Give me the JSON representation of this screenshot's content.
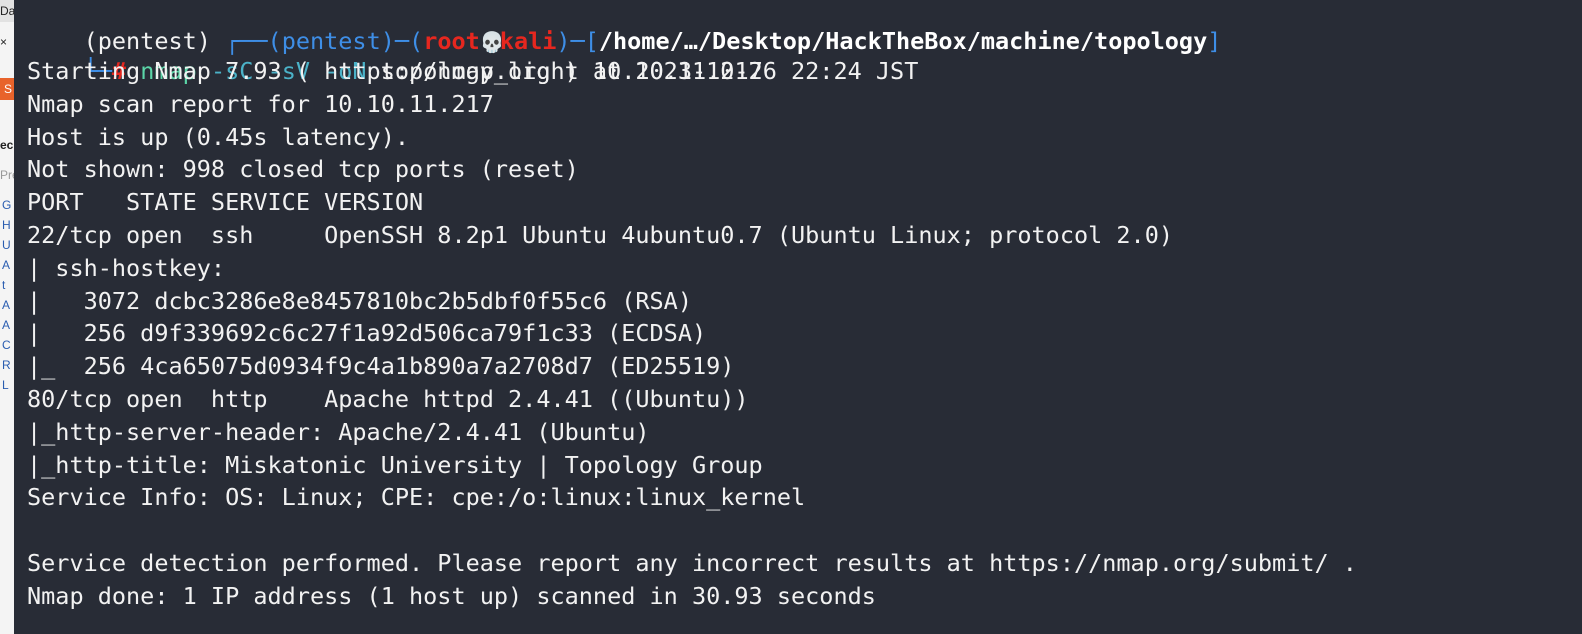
{
  "background_window": {
    "top_tab_fragment": "Das",
    "close_glyph": "×",
    "orange_fragment": "S",
    "section_fragment": "ec",
    "pre_fragment": "Pre",
    "links": [
      "G",
      "H",
      "U",
      "A",
      "t",
      "A",
      "A",
      "C",
      "R",
      "L"
    ]
  },
  "terminal": {
    "prompt": {
      "venv": "(pentest)",
      "corner_top": "┌──",
      "venv_inner": "(pentest)",
      "dash": "─",
      "open_paren": "(",
      "user": "root",
      "skull": "💀",
      "host": "kali",
      "close_paren": ")",
      "dash2": "─",
      "open_bracket": "[",
      "path": "/home/…/Desktop/HackTheBox/machine/topology",
      "close_bracket": "]",
      "corner_bottom": "└─",
      "hash": "#",
      "command": "nmap",
      "flags": "-sC -sV -oN",
      "args": "topology_light 10.10.11.217"
    },
    "output_lines": [
      "Starting Nmap 7.93 ( https://nmap.org ) at 2023-10-26 22:24 JST",
      "Nmap scan report for 10.10.11.217",
      "Host is up (0.45s latency).",
      "Not shown: 998 closed tcp ports (reset)",
      "PORT   STATE SERVICE VERSION",
      "22/tcp open  ssh     OpenSSH 8.2p1 Ubuntu 4ubuntu0.7 (Ubuntu Linux; protocol 2.0)",
      "| ssh-hostkey: ",
      "|   3072 dcbc3286e8e8457810bc2b5dbf0f55c6 (RSA)",
      "|   256 d9f339692c6c27f1a92d506ca79f1c33 (ECDSA)",
      "|_  256 4ca65075d0934f9c4a1b890a7a2708d7 (ED25519)",
      "80/tcp open  http    Apache httpd 2.4.41 ((Ubuntu))",
      "|_http-server-header: Apache/2.4.41 (Ubuntu)",
      "|_http-title: Miskatonic University | Topology Group",
      "Service Info: OS: Linux; CPE: cpe:/o:linux:linux_kernel",
      "",
      "Service detection performed. Please report any incorrect results at https://nmap.org/submit/ .",
      "Nmap done: 1 IP address (1 host up) scanned in 30.93 seconds"
    ]
  },
  "colors": {
    "terminal_bg": "#282c36",
    "text": "#f2f2f2",
    "prompt_blue": "#3e8ee6",
    "prompt_red": "#e6271f",
    "command_green": "#5bd6a8"
  }
}
